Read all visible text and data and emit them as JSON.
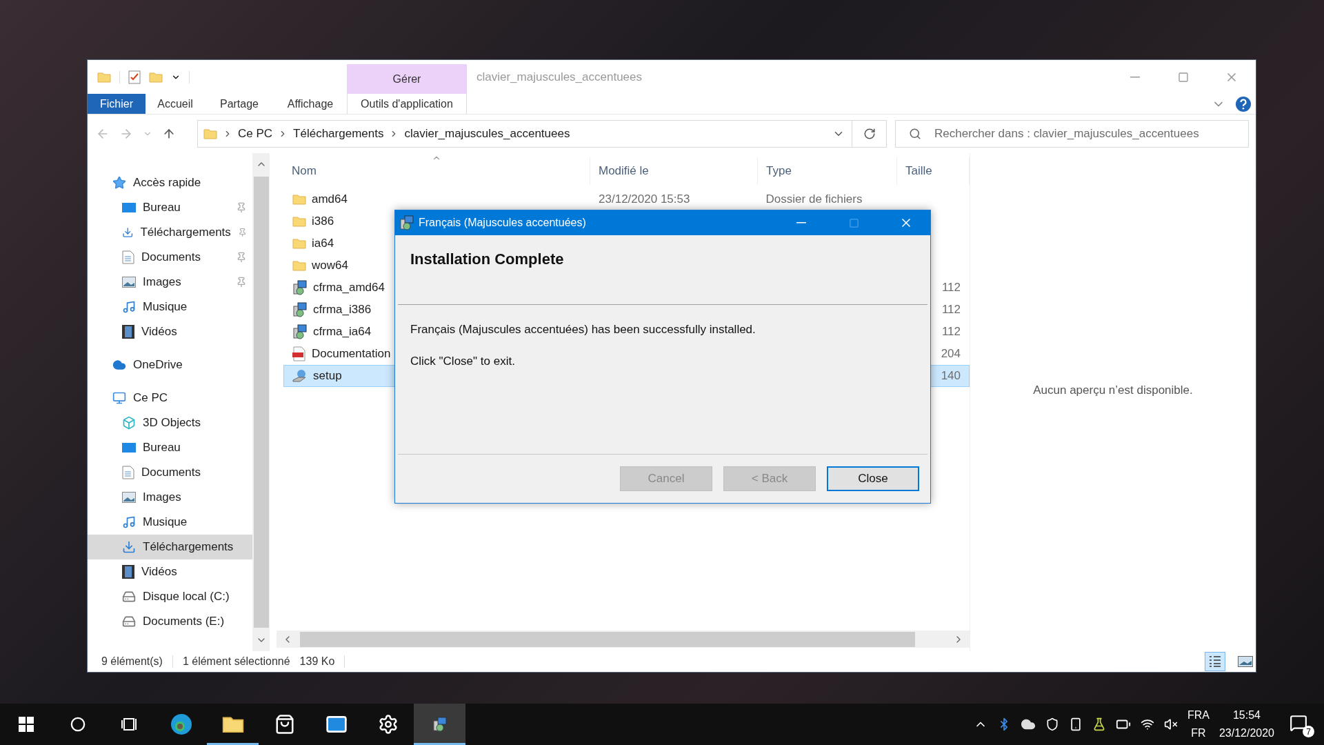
{
  "window": {
    "title": "clavier_majuscules_accentuees"
  },
  "ribbon": {
    "context_tab": "Gérer",
    "tabs": [
      {
        "label": "Fichier",
        "kind": "file"
      },
      {
        "label": "Accueil",
        "kind": "plain"
      },
      {
        "label": "Partage",
        "kind": "plain"
      },
      {
        "label": "Affichage",
        "kind": "plain"
      },
      {
        "label": "Outils d'application",
        "kind": "context"
      }
    ]
  },
  "address_bar": {
    "segments": [
      "Ce PC",
      "Téléchargements",
      "clavier_majuscules_accentuees"
    ]
  },
  "search": {
    "placeholder": "Rechercher dans : clavier_majuscules_accentuees"
  },
  "nav_pane": {
    "items": [
      {
        "label": "Accès rapide",
        "kind": "star",
        "selected": false,
        "children": [
          {
            "label": "Bureau",
            "kind": "desktop",
            "pinned": true,
            "selected": false
          },
          {
            "label": "Téléchargements",
            "kind": "download",
            "pinned": true,
            "selected": false
          },
          {
            "label": "Documents",
            "kind": "document",
            "pinned": true,
            "selected": false
          },
          {
            "label": "Images",
            "kind": "image",
            "pinned": true,
            "selected": false
          },
          {
            "label": "Musique",
            "kind": "music",
            "pinned": false,
            "selected": false
          },
          {
            "label": "Vidéos",
            "kind": "video",
            "pinned": false,
            "selected": false
          }
        ]
      },
      {
        "label": "OneDrive",
        "kind": "cloud",
        "selected": false
      },
      {
        "label": "Ce PC",
        "kind": "pc",
        "selected": false,
        "children": [
          {
            "label": "3D Objects",
            "kind": "cube",
            "pinned": false,
            "selected": false
          },
          {
            "label": "Bureau",
            "kind": "desktop",
            "pinned": false,
            "selected": false
          },
          {
            "label": "Documents",
            "kind": "document",
            "pinned": false,
            "selected": false
          },
          {
            "label": "Images",
            "kind": "image",
            "pinned": false,
            "selected": false
          },
          {
            "label": "Musique",
            "kind": "music",
            "pinned": false,
            "selected": false
          },
          {
            "label": "Téléchargements",
            "kind": "download",
            "pinned": false,
            "selected": true
          },
          {
            "label": "Vidéos",
            "kind": "video",
            "pinned": false,
            "selected": false
          },
          {
            "label": "Disque local (C:)",
            "kind": "drive",
            "pinned": false,
            "selected": false
          },
          {
            "label": "Documents (E:)",
            "kind": "drive",
            "pinned": false,
            "selected": false
          }
        ]
      }
    ]
  },
  "file_list": {
    "columns": [
      "Nom",
      "Modifié le",
      "Type",
      "Taille"
    ],
    "rows": [
      {
        "name": "amd64",
        "kind": "folder",
        "modified": "23/12/2020 15:53",
        "type": "Dossier de fichiers",
        "selected": false
      },
      {
        "name": "i386",
        "kind": "folder",
        "selected": false
      },
      {
        "name": "ia64",
        "kind": "folder",
        "selected": false
      },
      {
        "name": "wow64",
        "kind": "folder",
        "selected": false
      },
      {
        "name": "cfrma_amd64",
        "kind": "installer",
        "size": "112",
        "selected": false
      },
      {
        "name": "cfrma_i386",
        "kind": "installer",
        "size": "112",
        "selected": false
      },
      {
        "name": "cfrma_ia64",
        "kind": "installer",
        "size": "112",
        "selected": false
      },
      {
        "name": "Documentation",
        "kind": "pdf",
        "size": "204",
        "selected": false
      },
      {
        "name": "setup",
        "kind": "setup",
        "size": "140",
        "selected": true
      }
    ]
  },
  "preview": {
    "message": "Aucun aperçu n’est disponible."
  },
  "status_bar": {
    "count": "9 élément(s)",
    "selection": "1 élément sélectionné",
    "selection_size": "139 Ko",
    "views": [
      {
        "kind": "details",
        "selected": true
      },
      {
        "kind": "tiles",
        "selected": false
      }
    ]
  },
  "dialog": {
    "title": "Français (Majuscules accentuées)",
    "heading": "Installation Complete",
    "message": "Français (Majuscules accentuées) has been successfully installed.",
    "hint": "Click \"Close\" to exit.",
    "buttons": [
      {
        "label": "Cancel",
        "disabled": true,
        "default": false
      },
      {
        "label": "< Back",
        "disabled": true,
        "default": false
      },
      {
        "label": "Close",
        "disabled": false,
        "default": true
      }
    ]
  },
  "taskbar": {
    "apps": [
      {
        "kind": "start",
        "running": false,
        "selected": false
      },
      {
        "kind": "search",
        "running": false,
        "selected": false
      },
      {
        "kind": "taskview",
        "running": false,
        "selected": false
      },
      {
        "kind": "browser",
        "running": false,
        "selected": false
      },
      {
        "kind": "explorer",
        "running": true,
        "selected": false
      },
      {
        "kind": "store",
        "running": false,
        "selected": false
      },
      {
        "kind": "mail",
        "running": false,
        "selected": false
      },
      {
        "kind": "settings",
        "running": false,
        "selected": false
      },
      {
        "kind": "installer",
        "running": true,
        "selected": true
      }
    ],
    "tray": {
      "language": "FRA",
      "layout": "FR",
      "time": "15:54",
      "date": "23/12/2020",
      "notifications": "7"
    }
  }
}
